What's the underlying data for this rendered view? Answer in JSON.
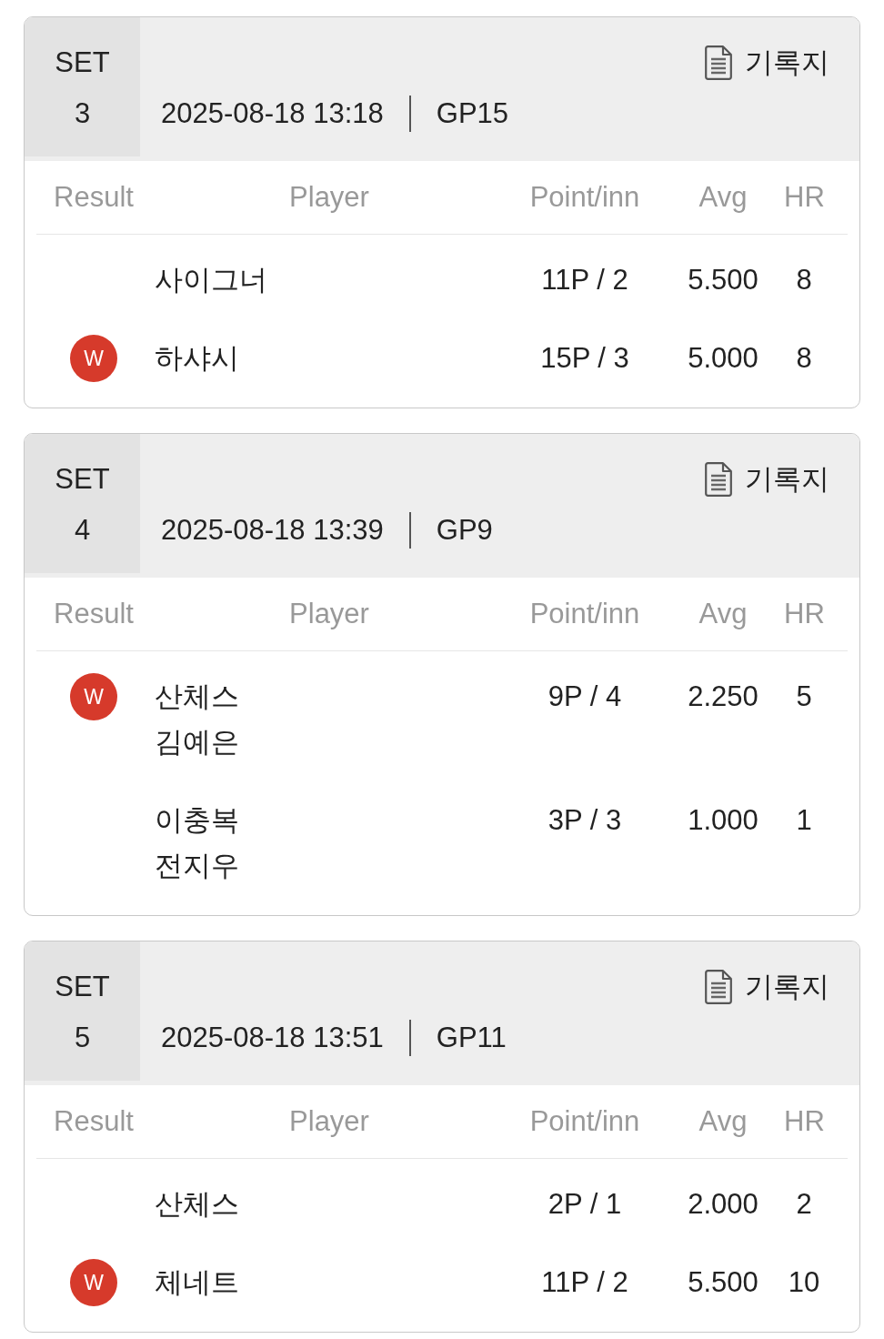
{
  "sets": [
    {
      "label": "SET",
      "number": "3",
      "datetime": "2025-08-18 13:18",
      "table": "GP15",
      "record_link": "기록지",
      "columns": [
        "Result",
        "Player",
        "Point/inn",
        "Avg",
        "HR"
      ],
      "rows": [
        {
          "players": [
            "사이그너"
          ],
          "points": "11P / 2",
          "avg": "5.500",
          "hr": "8"
        },
        {
          "result": "W",
          "players": [
            "하샤시"
          ],
          "points": "15P / 3",
          "avg": "5.000",
          "hr": "8"
        }
      ]
    },
    {
      "label": "SET",
      "number": "4",
      "datetime": "2025-08-18 13:39",
      "table": "GP9",
      "record_link": "기록지",
      "columns": [
        "Result",
        "Player",
        "Point/inn",
        "Avg",
        "HR"
      ],
      "rows": [
        {
          "result": "W",
          "players": [
            "산체스",
            "김예은"
          ],
          "points": "9P / 4",
          "avg": "2.250",
          "hr": "5"
        },
        {
          "players": [
            "이충복",
            "전지우"
          ],
          "points": "3P / 3",
          "avg": "1.000",
          "hr": "1"
        }
      ]
    },
    {
      "label": "SET",
      "number": "5",
      "datetime": "2025-08-18 13:51",
      "table": "GP11",
      "record_link": "기록지",
      "columns": [
        "Result",
        "Player",
        "Point/inn",
        "Avg",
        "HR"
      ],
      "rows": [
        {
          "players": [
            "산체스"
          ],
          "points": "2P / 1",
          "avg": "2.000",
          "hr": "2"
        },
        {
          "result": "W",
          "players": [
            "체네트"
          ],
          "points": "11P / 2",
          "avg": "5.500",
          "hr": "10"
        }
      ]
    }
  ]
}
